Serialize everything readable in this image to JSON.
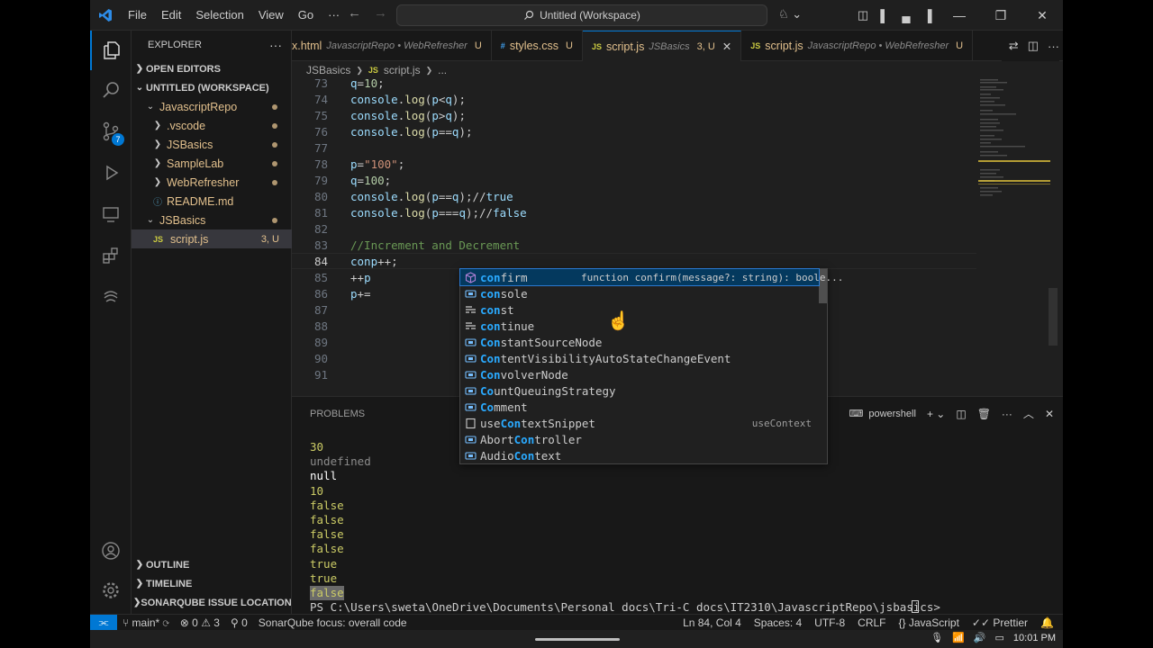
{
  "menu": [
    "File",
    "Edit",
    "Selection",
    "View",
    "Go",
    "···"
  ],
  "title": "Untitled (Workspace)",
  "explorer": {
    "header": "EXPLORER",
    "open_editors": "OPEN EDITORS",
    "workspace": "UNTITLED (WORKSPACE)",
    "tree": [
      {
        "label": "JavascriptRepo",
        "indent": 1,
        "type": "folder-open"
      },
      {
        "label": ".vscode",
        "indent": 2,
        "type": "folder"
      },
      {
        "label": "JSBasics",
        "indent": 2,
        "type": "folder"
      },
      {
        "label": "SampleLab",
        "indent": 2,
        "type": "folder"
      },
      {
        "label": "WebRefresher",
        "indent": 2,
        "type": "folder"
      },
      {
        "label": "README.md",
        "indent": 2,
        "type": "info-file"
      },
      {
        "label": "JSBasics",
        "indent": 1,
        "type": "folder-open"
      },
      {
        "label": "script.js",
        "indent": 2,
        "type": "js",
        "status": "3, U"
      }
    ],
    "outline": "OUTLINE",
    "timeline": "TIMELINE",
    "sonar": "SONARQUBE ISSUE LOCATIONS"
  },
  "tabs": [
    {
      "name": "x.html",
      "desc": "JavascriptRepo • WebRefresher",
      "status": "U"
    },
    {
      "name": "styles.css",
      "desc": "",
      "status": "U"
    },
    {
      "name": "script.js",
      "desc": "JSBasics",
      "status": "3, U"
    },
    {
      "name": "script.js",
      "desc": "JavascriptRepo • WebRefresher",
      "status": "U"
    }
  ],
  "breadcrumb": [
    "JSBasics",
    "script.js",
    "..."
  ],
  "code_lines": [
    {
      "n": "73",
      "text": "q=10;"
    },
    {
      "n": "74",
      "text": "console.log(p<q);"
    },
    {
      "n": "75",
      "text": "console.log(p>q);"
    },
    {
      "n": "76",
      "text": "console.log(p==q);"
    },
    {
      "n": "77",
      "text": ""
    },
    {
      "n": "78",
      "text": "p=\"100\";"
    },
    {
      "n": "79",
      "text": "q=100;"
    },
    {
      "n": "80",
      "text": "console.log(p==q);//true"
    },
    {
      "n": "81",
      "text": "console.log(p===q);//false"
    },
    {
      "n": "82",
      "text": ""
    },
    {
      "n": "83",
      "text": "//Increment and Decrement"
    },
    {
      "n": "84",
      "text": "conp++;"
    },
    {
      "n": "85",
      "text": "++p"
    },
    {
      "n": "86",
      "text": "p+="
    },
    {
      "n": "87",
      "text": ""
    },
    {
      "n": "88",
      "text": ""
    },
    {
      "n": "89",
      "text": ""
    },
    {
      "n": "90",
      "text": ""
    },
    {
      "n": "91",
      "text": ""
    }
  ],
  "suggestions": [
    {
      "label": "confirm",
      "hl": "con",
      "icon": "cube",
      "detail": "function confirm(message?: string): boole..."
    },
    {
      "label": "console",
      "hl": "con",
      "icon": "var"
    },
    {
      "label": "const",
      "hl": "con",
      "icon": "keyword"
    },
    {
      "label": "continue",
      "hl": "con",
      "icon": "keyword"
    },
    {
      "label": "ConstantSourceNode",
      "hl": "Con",
      "icon": "var"
    },
    {
      "label": "ContentVisibilityAutoStateChangeEvent",
      "hl": "Con",
      "icon": "var"
    },
    {
      "label": "ConvolverNode",
      "hl": "Con",
      "icon": "var"
    },
    {
      "label": "CountQueuingStrategy",
      "hl": "Co",
      "icon": "var"
    },
    {
      "label": "Comment",
      "hl": "Co",
      "icon": "var"
    },
    {
      "label": "useContextSnippet",
      "hl": "",
      "icon": "snippet",
      "right": "useContext"
    },
    {
      "label": "AbortController",
      "hl": "",
      "icon": "var"
    },
    {
      "label": "AudioContext",
      "hl": "",
      "icon": "var"
    }
  ],
  "panel": {
    "problems": "PROBLEMS",
    "shell": "powershell",
    "output": [
      {
        "text": "30",
        "color": "#cccc66"
      },
      {
        "text": "undefined",
        "color": "#8b8b8b"
      },
      {
        "text": "null",
        "color": "#ffffff"
      },
      {
        "text": "10",
        "color": "#cccc66"
      },
      {
        "text": "false",
        "color": "#cccc66"
      },
      {
        "text": "false",
        "color": "#cccc66"
      },
      {
        "text": "false",
        "color": "#cccc66"
      },
      {
        "text": "false",
        "color": "#cccc66"
      },
      {
        "text": "true",
        "color": "#cccc66"
      },
      {
        "text": "true",
        "color": "#cccc66"
      },
      {
        "text": "false",
        "color": "#cccc66"
      }
    ],
    "prompt": "PS C:\\Users\\sweta\\OneDrive\\Documents\\Personal docs\\Tri-C docs\\IT2310\\JavascriptRepo\\jsbasics> "
  },
  "status": {
    "branch": "main*",
    "errors": "0",
    "warnings": "3",
    "ports": "0",
    "sonar": "SonarQube focus: overall code",
    "position": "Ln 84, Col 4",
    "spaces": "Spaces: 4",
    "encoding": "UTF-8",
    "eol": "CRLF",
    "language": "JavaScript",
    "prettier": "Prettier"
  },
  "clock": "10:01 PM",
  "colors": {
    "accent": "#0078d4",
    "keyword": "#569cd6",
    "string": "#ce9178",
    "number": "#b5cea8",
    "comment": "#6a9955",
    "func": "#dcdcaa",
    "variable": "#9cdcfe"
  }
}
